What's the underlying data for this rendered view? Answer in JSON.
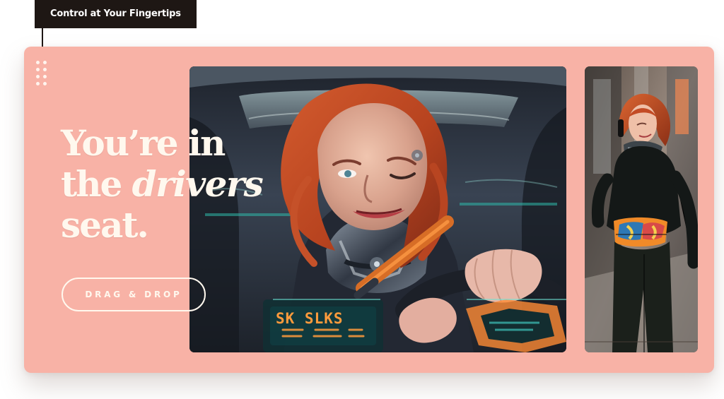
{
  "label": {
    "text": "Control at Your Fingertips"
  },
  "hero": {
    "line1": "You’re in",
    "line2_plain": "the ",
    "line2_italic": "drivers",
    "line3": "seat.",
    "button_label": "DRAG & DROP"
  },
  "main_photo": {
    "dashboard_text": "SK SLKS"
  },
  "colors": {
    "background": "#ffffff",
    "panel": "#f8b2a6",
    "label_background": "#1e1714",
    "headline_text": "#fff8ee",
    "button_border": "#fff8ee"
  },
  "icons": {
    "drag_handle": "grip-dots-icon"
  }
}
